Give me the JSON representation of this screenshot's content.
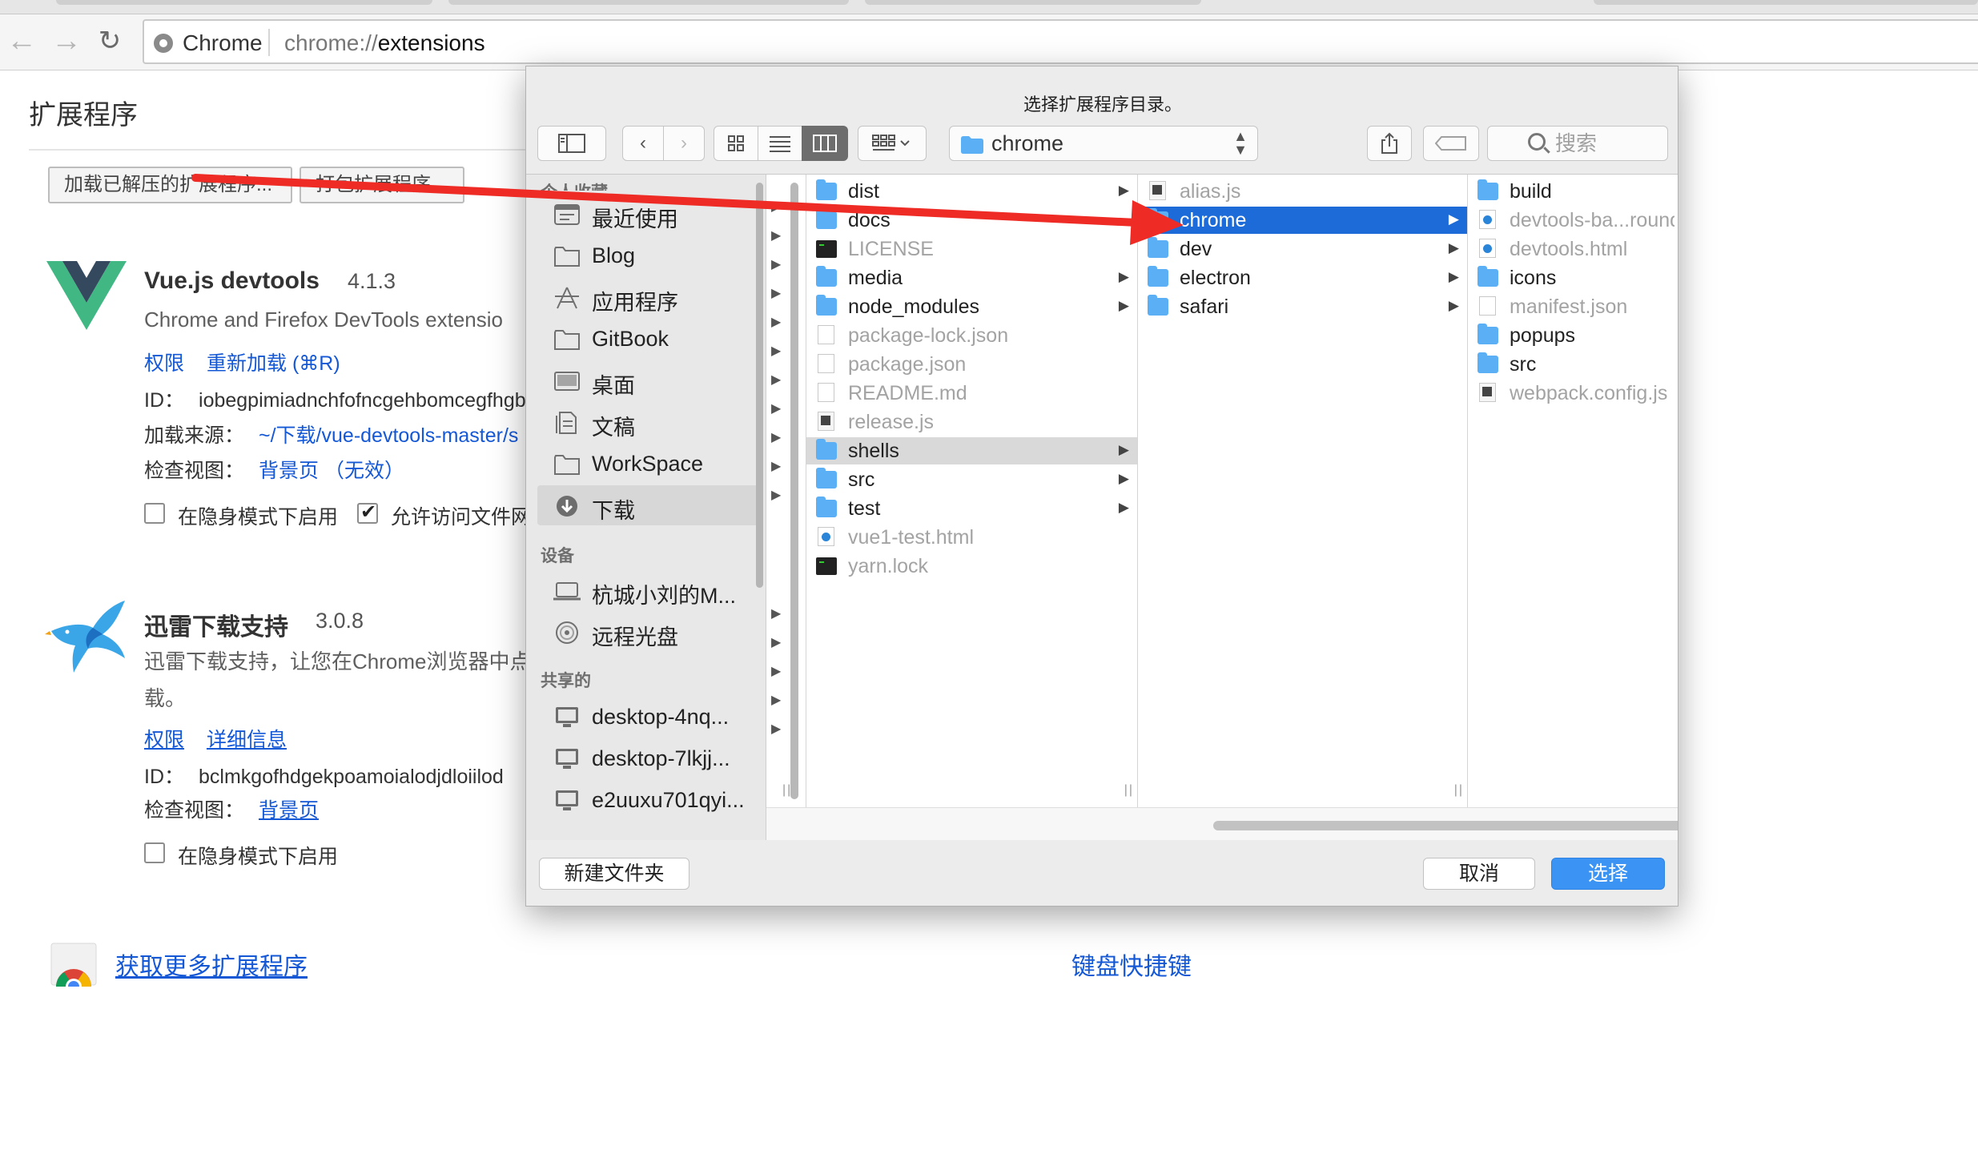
{
  "browser": {
    "chip_label": "Chrome",
    "url_scheme": "chrome://",
    "url_host": "extensions"
  },
  "page": {
    "title": "扩展程序",
    "load_unpacked_button": "加载已解压的扩展程序...",
    "pack_button": "打包扩展程序..."
  },
  "extensions": [
    {
      "name": "Vue.js devtools",
      "version": "4.1.3",
      "description": "Chrome and Firefox DevTools extensio",
      "link_permissions": "权限",
      "link_reload": "重新加载 (⌘R)",
      "id_label": "ID：",
      "id_value": "iobegpimiadnchfofncgehbomcegfhgb",
      "source_label": "加载来源：",
      "source_value": "~/下载/vue-devtools-master/s",
      "inspect_label": "检查视图：",
      "inspect_value": "背景页 （无效）",
      "incognito_label": "在隐身模式下启用",
      "file_access_label": "允许访问文件网"
    },
    {
      "name": "迅雷下载支持",
      "version": "3.0.8",
      "description_line1": "迅雷下载支持，让您在Chrome浏览器中点",
      "description_line2": "载。",
      "link_permissions": "权限",
      "link_details": "详细信息",
      "id_label": "ID：",
      "id_value": "bclmkgofhdgekpoamoialodjdloiilod",
      "inspect_label": "检查视图：",
      "inspect_value": "背景页",
      "incognito_label": "在隐身模式下启用"
    }
  ],
  "footer_links": {
    "get_more": "获取更多扩展程序",
    "shortcuts": "键盘快捷键"
  },
  "dialog": {
    "title": "选择扩展程序目录。",
    "path": "chrome",
    "search_placeholder": "搜索",
    "sidebar": {
      "section_favorites_partial": "个人收藏",
      "favorites": [
        "最近使用",
        "Blog",
        "应用程序",
        "GitBook",
        "桌面",
        "文稿",
        "WorkSpace",
        "下载"
      ],
      "section_devices": "设备",
      "devices": [
        "杭城小刘的M...",
        "远程光盘"
      ],
      "section_shared": "共享的",
      "shared": [
        "desktop-4nq...",
        "desktop-7lkjj...",
        "e2uuxu701qyi..."
      ]
    },
    "column1": [
      {
        "name": "dist",
        "type": "folder",
        "arrow": true
      },
      {
        "name": "docs",
        "type": "folder",
        "arrow": false
      },
      {
        "name": "LICENSE",
        "type": "term",
        "arrow": false
      },
      {
        "name": "media",
        "type": "folder",
        "arrow": true
      },
      {
        "name": "node_modules",
        "type": "folder",
        "arrow": true
      },
      {
        "name": "package-lock.json",
        "type": "doc",
        "arrow": false
      },
      {
        "name": "package.json",
        "type": "doc",
        "arrow": false
      },
      {
        "name": "README.md",
        "type": "doc",
        "arrow": false
      },
      {
        "name": "release.js",
        "type": "js",
        "arrow": false
      },
      {
        "name": "shells",
        "type": "folder",
        "arrow": true,
        "selected": "gray"
      },
      {
        "name": "src",
        "type": "folder",
        "arrow": true
      },
      {
        "name": "test",
        "type": "folder",
        "arrow": true
      },
      {
        "name": "vue1-test.html",
        "type": "html",
        "arrow": false
      },
      {
        "name": "yarn.lock",
        "type": "term",
        "arrow": false
      }
    ],
    "column2": [
      {
        "name": "alias.js",
        "type": "js",
        "arrow": false
      },
      {
        "name": "chrome",
        "type": "folder",
        "arrow": true,
        "selected": "blue"
      },
      {
        "name": "dev",
        "type": "folder",
        "arrow": true
      },
      {
        "name": "electron",
        "type": "folder",
        "arrow": true
      },
      {
        "name": "safari",
        "type": "folder",
        "arrow": true
      }
    ],
    "column3": [
      {
        "name": "build",
        "type": "folder"
      },
      {
        "name": "devtools-ba...round.html",
        "type": "html"
      },
      {
        "name": "devtools.html",
        "type": "html"
      },
      {
        "name": "icons",
        "type": "folder"
      },
      {
        "name": "manifest.json",
        "type": "doc"
      },
      {
        "name": "popups",
        "type": "folder"
      },
      {
        "name": "src",
        "type": "folder"
      },
      {
        "name": "webpack.config.js",
        "type": "js"
      }
    ],
    "new_folder_button": "新建文件夹",
    "cancel_button": "取消",
    "choose_button": "选择"
  },
  "colors": {
    "link": "#1558d6",
    "selection_blue": "#1d6bd9",
    "folder_blue": "#5bb0f5",
    "primary_button": "#3b94f4",
    "annotation_arrow": "#ee2b25"
  }
}
